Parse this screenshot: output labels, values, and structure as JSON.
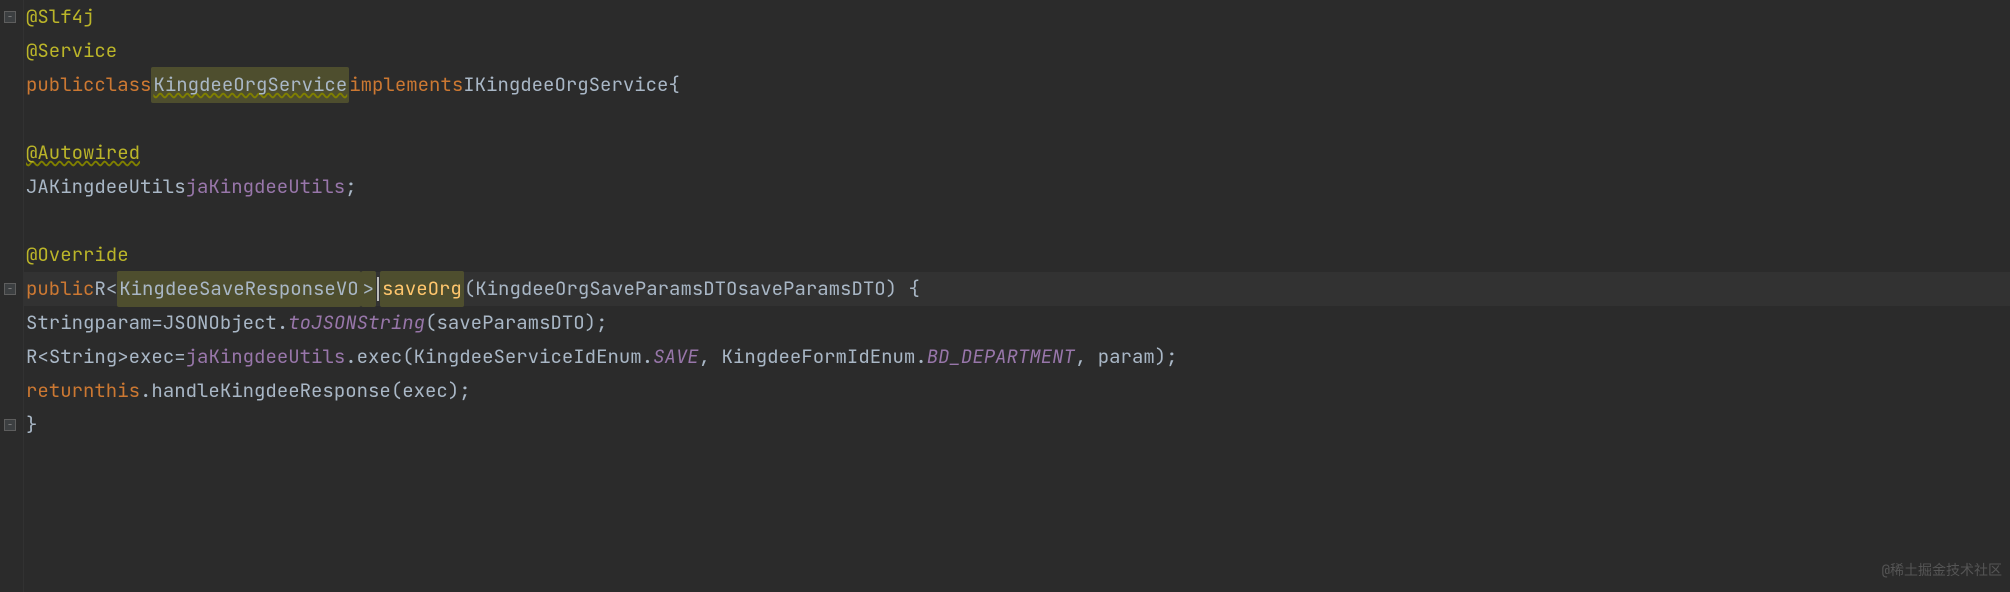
{
  "annotations": {
    "slf4j": "@Slf4j",
    "service": "@Service",
    "autowired": "@Autowired",
    "override": "@Override"
  },
  "keywords": {
    "public": "public",
    "class": "class",
    "implements": "implements",
    "return": "return",
    "this": "this"
  },
  "class_decl": {
    "name": "KingdeeOrgService",
    "interface": "IKingdeeOrgService"
  },
  "field": {
    "type": "JAKingdeeUtils",
    "name": "jaKingdeeUtils"
  },
  "method": {
    "return_outer": "R",
    "return_generic": "KingdeeSaveResponseVO",
    "name": "saveOrg",
    "param_type": "KingdeeOrgSaveParamsDTO",
    "param_name": "saveParamsDTO"
  },
  "body": {
    "string_type": "String",
    "param_var": "param",
    "json_class": "JSONObject",
    "tojson": "toJSONString",
    "saveparams_arg": "saveParamsDTO",
    "r_type": "R",
    "r_generic": "String",
    "exec_var": "exec",
    "utils_ref": "jaKingdeeUtils",
    "exec_method": "exec",
    "enum1": "KingdeeServiceIdEnum",
    "enum1_val": "SAVE",
    "enum2": "KingdeeFormIdEnum",
    "enum2_val": "BD_DEPARTMENT",
    "param_arg": "param",
    "handle_method": "handleKingdeeResponse",
    "exec_arg": "exec"
  },
  "watermark": "@稀土掘金技术社区",
  "colors": {
    "bg": "#2b2b2b",
    "keyword": "#cc7832",
    "annotation": "#bbb529",
    "method": "#ffc66d",
    "field": "#9876aa"
  }
}
